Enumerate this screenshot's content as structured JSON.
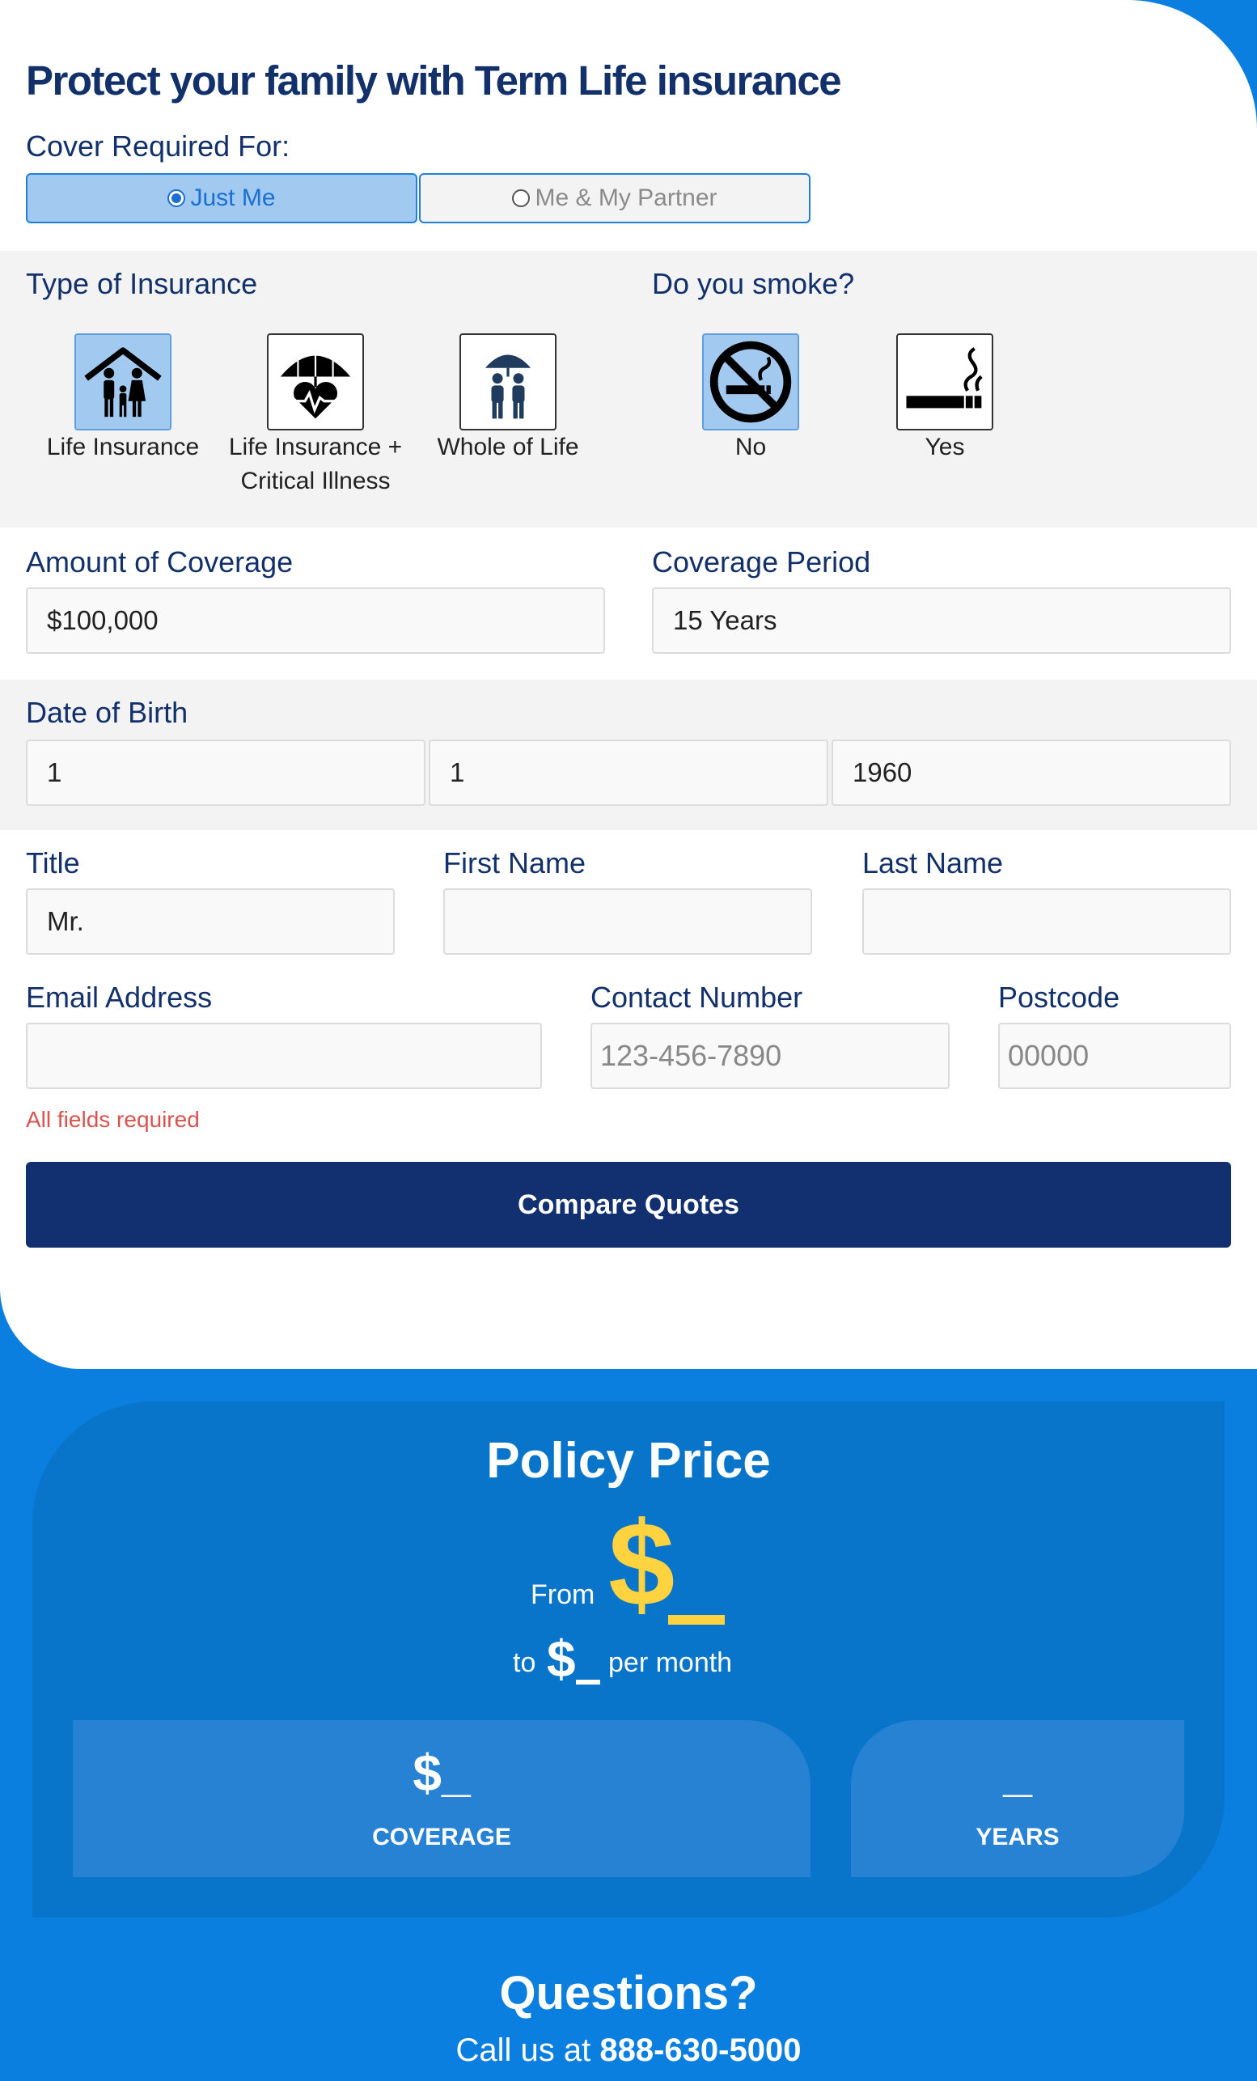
{
  "form": {
    "title": "Protect your family with Term Life insurance",
    "cover_label": "Cover Required For:",
    "cover_options": [
      "Just Me",
      "Me & My Partner"
    ],
    "cover_selected": "Just Me",
    "insurance_label": "Type of Insurance",
    "insurance_types": [
      {
        "line1": "Life Insurance",
        "line2": "",
        "icon": "family-house-icon",
        "selected": true
      },
      {
        "line1": "Life Insurance +",
        "line2": "Critical Illness",
        "icon": "umbrella-heart-icon",
        "selected": false
      },
      {
        "line1": "Whole of Life",
        "line2": "",
        "icon": "umbrella-people-icon",
        "selected": false
      }
    ],
    "smoke_label": "Do you smoke?",
    "smoke_options": [
      {
        "label": "No",
        "icon": "no-smoking-icon",
        "selected": true
      },
      {
        "label": "Yes",
        "icon": "cigarette-icon",
        "selected": false
      }
    ],
    "coverage_amount_label": "Amount of Coverage",
    "coverage_amount": "$100,000",
    "coverage_period_label": "Coverage Period",
    "coverage_period": "15 Years",
    "dob_label": "Date of Birth",
    "dob_day": "1",
    "dob_month": "1",
    "dob_year": "1960",
    "title_label": "Title",
    "title_value": "Mr.",
    "first_name_label": "First Name",
    "first_name_value": "",
    "last_name_label": "Last Name",
    "last_name_value": "",
    "email_label": "Email Address",
    "email_value": "",
    "contact_label": "Contact Number",
    "contact_placeholder": "123-456-7890",
    "postcode_label": "Postcode",
    "postcode_placeholder": "00000",
    "required_note": "All fields required",
    "submit_label": "Compare Quotes"
  },
  "price": {
    "title": "Policy Price",
    "from_label": "From",
    "from_value": "$",
    "to_label": "to",
    "to_value": "$",
    "per_month": "per month",
    "coverage_value": "$_",
    "coverage_label": "COVERAGE",
    "years_value": "_",
    "years_label": "YEARS"
  },
  "footer": {
    "questions": "Questions?",
    "call_text": "Call us at",
    "phone": "888-630-5000"
  },
  "colors": {
    "brand_navy": "#12306a",
    "brand_blue": "#0a7fe0",
    "panel_blue": "#0875cb",
    "accent_yellow": "#ffd23f",
    "error_red": "#d9534f",
    "selected_fill": "#a2c9ef"
  }
}
